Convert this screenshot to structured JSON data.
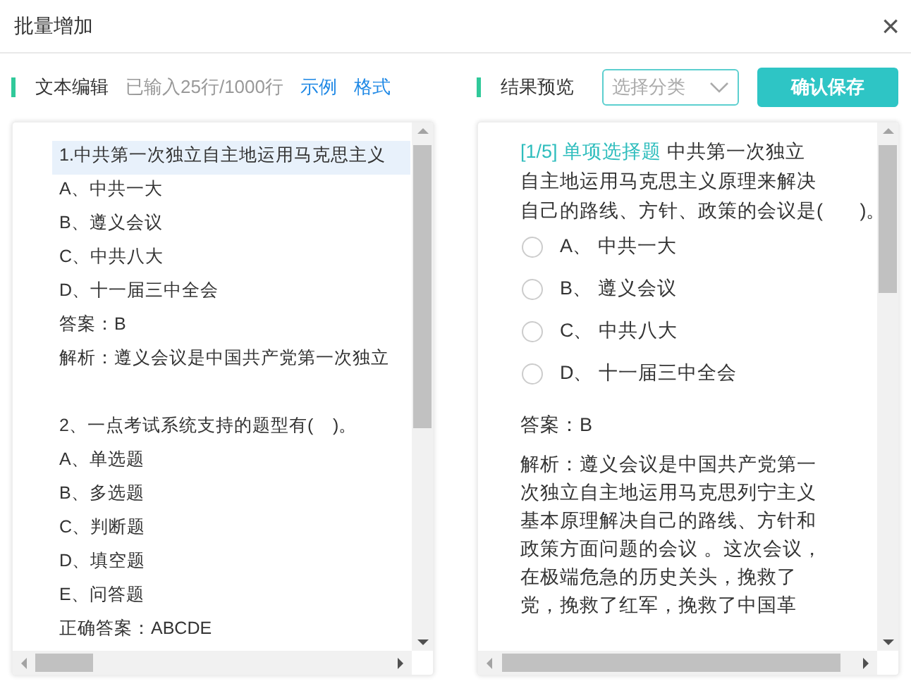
{
  "window": {
    "title": "批量增加",
    "close": "×"
  },
  "editor": {
    "label": "文本编辑",
    "stats": "已输入25行/1000行",
    "links": [
      "示例",
      "格式"
    ],
    "lines": [
      {
        "text": "1.中共第一次独立自主地运用马克思主义",
        "selected": true
      },
      {
        "text": "A、中共一大",
        "selected": false
      },
      {
        "text": "B、遵义会议",
        "selected": false
      },
      {
        "text": "C、中共八大",
        "selected": false
      },
      {
        "text": "D、十一届三中全会",
        "selected": false
      },
      {
        "text": "答案：B",
        "selected": false
      },
      {
        "text": "解析：遵义会议是中国共产党第一次独立",
        "selected": false
      },
      {
        "selected": false
      },
      {
        "text": "2、一点考试系统支持的题型有(    )。",
        "selected": false
      },
      {
        "text": "A、单选题",
        "selected": false
      },
      {
        "text": "B、多选题",
        "selected": false
      },
      {
        "text": "C、判断题",
        "selected": false
      },
      {
        "text": "D、填空题",
        "selected": false
      },
      {
        "text": "E、问答题",
        "selected": false
      },
      {
        "text": "正确答案：ABCDE",
        "selected": false
      }
    ]
  },
  "preview": {
    "label": "结果预览",
    "category": {
      "placeholder": "选择分类"
    },
    "save_button": "确认保存",
    "question": {
      "index": "[1/5]",
      "type": "单项选择题",
      "stem_lines": [
        "中共第一次独立",
        "自主地运用马克思主义原理来解决",
        "自己的路线、方针、政策的会议是(       )。"
      ],
      "options": [
        {
          "letter": "A、",
          "text": "中共一大",
          "selected": false
        },
        {
          "letter": "B、",
          "text": "遵义会议",
          "selected": false
        },
        {
          "letter": "C、",
          "text": "中共八大",
          "selected": false
        },
        {
          "letter": "D、",
          "text": "十一届三中全会",
          "selected": false
        }
      ],
      "answer": "答案：B",
      "analysis_lines": [
        "解析：遵义会议是中国共产党第一",
        "次独立自主地运用马克思列宁主义",
        "基本原理解决自己的路线、方针和",
        "政策方面问题的会议 。这次会议，",
        "在极端危急的历史关头，挽救了",
        "党，挽救了红军，挽救了中国革"
      ]
    }
  }
}
